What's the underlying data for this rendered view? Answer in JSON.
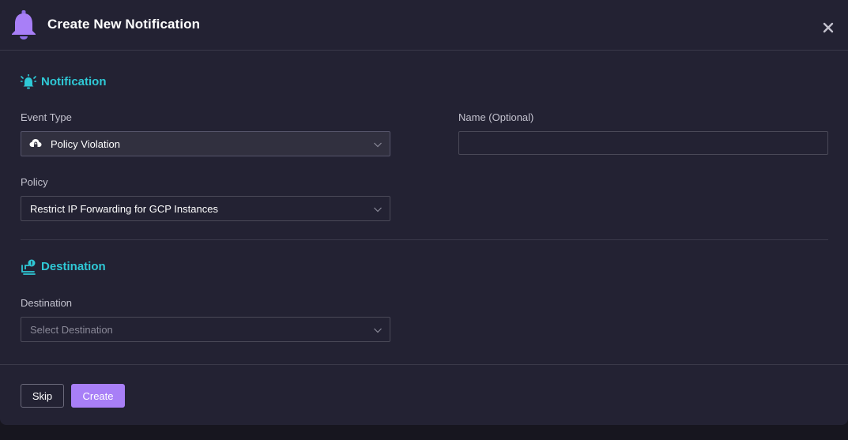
{
  "header": {
    "title": "Create New Notification",
    "icon": "bell-icon",
    "close_icon": "close-icon"
  },
  "notification_section": {
    "title": "Notification",
    "icon": "alarm-bell-icon",
    "event_type": {
      "label": "Event Type",
      "value": "Policy Violation",
      "icon": "cloud-lock-icon"
    },
    "name": {
      "label": "Name (Optional)",
      "value": "",
      "placeholder": ""
    },
    "policy": {
      "label": "Policy",
      "value": "Restrict IP Forwarding for GCP Instances"
    }
  },
  "destination_section": {
    "title": "Destination",
    "icon": "destination-icon",
    "destination": {
      "label": "Destination",
      "placeholder": "Select Destination"
    }
  },
  "footer": {
    "skip_label": "Skip",
    "create_label": "Create"
  },
  "colors": {
    "accent_purple": "#a87ff7",
    "section_teal": "#2fc9d6",
    "modal_bg": "#232233"
  }
}
